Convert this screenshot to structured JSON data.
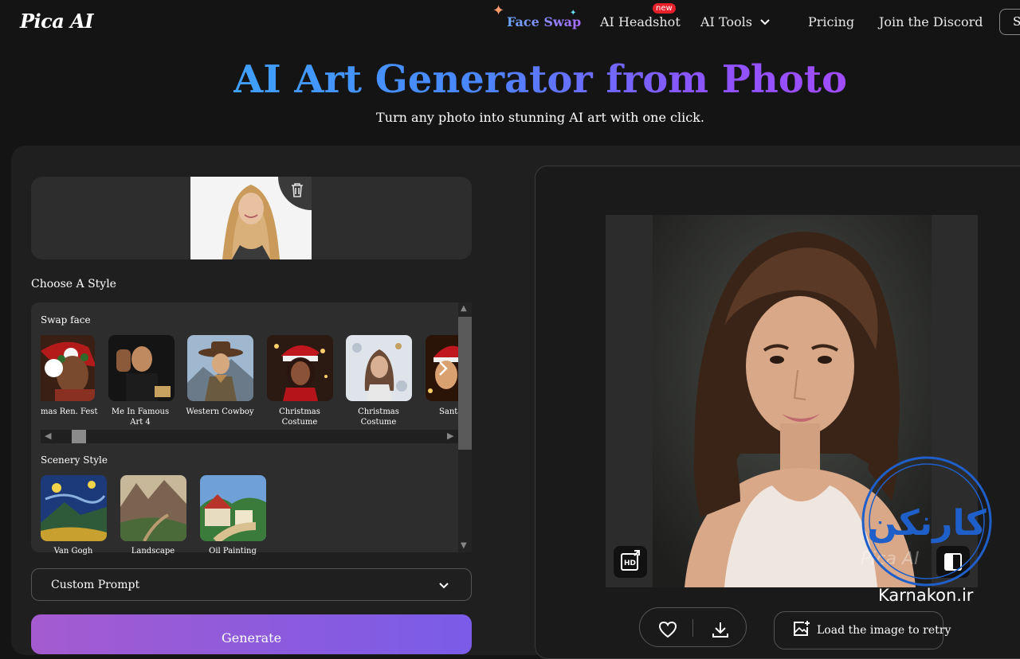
{
  "header": {
    "logo": "Pica AI",
    "nav": {
      "face_swap": "Face Swap",
      "ai_headshot": "AI Headshot",
      "new_badge": "new",
      "ai_tools": "AI Tools",
      "pricing": "Pricing",
      "discord": "Join the Discord"
    },
    "signin_label": "S"
  },
  "hero": {
    "title": "AI Art Generator from Photo",
    "subtitle": "Turn any photo into stunning AI art with one click."
  },
  "style_chooser": {
    "label": "Choose A Style",
    "swap_face": {
      "title": "Swap face",
      "items": [
        {
          "label": "mas Ren. Fest"
        },
        {
          "label": "Me In Famous Art 4"
        },
        {
          "label": "Western Cowboy"
        },
        {
          "label": "Christmas Costume"
        },
        {
          "label": "Christmas Costume"
        },
        {
          "label": "Santa"
        }
      ]
    },
    "scenery": {
      "title": "Scenery Style",
      "items": [
        {
          "label": "Van Gogh"
        },
        {
          "label": "Landscape"
        },
        {
          "label": "Oil Painting"
        }
      ]
    }
  },
  "custom_prompt": {
    "label": "Custom Prompt"
  },
  "generate": {
    "label": "Generate"
  },
  "result": {
    "watermark": "Pica AI",
    "retry_label": "Load the image to retry"
  },
  "overlay": {
    "stamp_text": "کارنکن",
    "site": "Karnakon.ir"
  },
  "colors": {
    "background": "#141414",
    "panel": "#1f1f1f",
    "card": "#2d2d2d",
    "title_gradient_start": "#3fa0ff",
    "title_gradient_end": "#a14cff",
    "generate_gradient_start": "#a55bd0",
    "generate_gradient_end": "#7a5ce8",
    "badge_red": "#e5202a",
    "stamp_blue": "#1f5fc9"
  }
}
